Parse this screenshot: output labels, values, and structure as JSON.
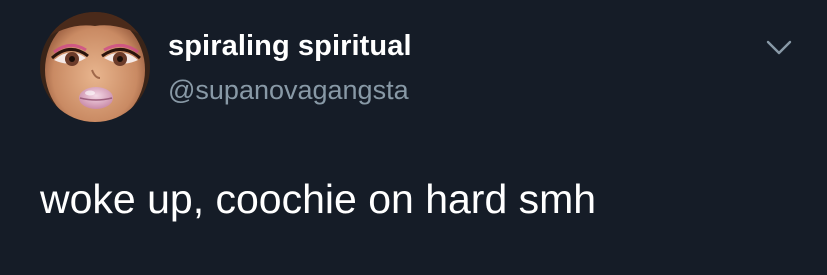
{
  "tweet": {
    "author": {
      "display_name": "spiraling spiritual",
      "handle": "@supanovagangsta",
      "avatar_icon": "doll-face-avatar"
    },
    "text": "woke up, coochie on hard smh",
    "menu_icon": "chevron-down-icon"
  },
  "colors": {
    "background": "#151c27",
    "primary_text": "#ffffff",
    "secondary_text": "#8899a6"
  }
}
